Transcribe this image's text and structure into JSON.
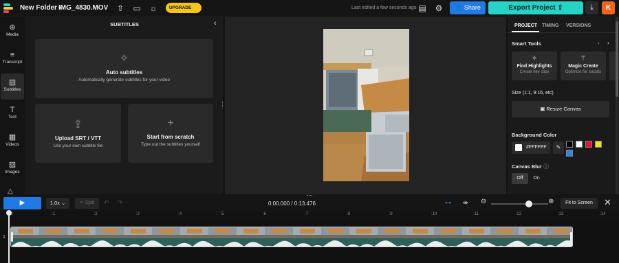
{
  "header": {
    "folder": "New Folder ›",
    "filename": "IMG_4830.MOV",
    "upgrade": "UPGRADE ⚡",
    "last_edited": "Last edited a few seconds ago",
    "share": "Share",
    "export": "Export Project ⇪",
    "avatar": "K"
  },
  "rail": [
    {
      "label": "Media",
      "icon": "⊕"
    },
    {
      "label": "Transcript",
      "icon": "≡"
    },
    {
      "label": "Subtitles",
      "icon": "▤"
    },
    {
      "label": "Text",
      "icon": "T"
    },
    {
      "label": "Videos",
      "icon": "▦"
    },
    {
      "label": "Images",
      "icon": "▨"
    }
  ],
  "subtitles": {
    "title": "SUBTITLES",
    "auto": {
      "title": "Auto subtitles",
      "desc": "Automatically generate subtitles for your video"
    },
    "upload": {
      "title": "Upload SRT / VTT",
      "desc": "Use your own subtitle file"
    },
    "scratch": {
      "title": "Start from scratch",
      "desc": "Type out the subtitles yourself"
    }
  },
  "right": {
    "tabs": [
      "PROJECT",
      "TIMING",
      "VERSIONS"
    ],
    "smart_tools": "Smart Tools",
    "tools": [
      {
        "title": "Find Highlights",
        "desc": "Create key clips"
      },
      {
        "title": "Magic Create",
        "desc": "Optimize for socials"
      }
    ],
    "size_label": "Size (1:1, 9:16, etc)",
    "resize": "Resize Canvas",
    "bg_label": "Background Color",
    "bg_value": "#FFFFFF",
    "swatches": [
      "#000000",
      "#ffffff",
      "#e8112d",
      "#f5e10f",
      "#2a86e8"
    ],
    "blur_label": "Canvas Blur",
    "blur_off": "Off",
    "blur_on": "On"
  },
  "timeline": {
    "speed": "1.0x ⌄",
    "split": "✂ Split",
    "time": "0:00.000 / 0:13.476",
    "fit": "Fit to Screen",
    "zoom_level": 0.66,
    "ticks": [
      ":0",
      ":1",
      ":2",
      ":3",
      ":4",
      ":5",
      ":6",
      ":7",
      ":8",
      ":9",
      ":10",
      ":11",
      ":12",
      ":13",
      ":14"
    ],
    "track_number": "1"
  }
}
